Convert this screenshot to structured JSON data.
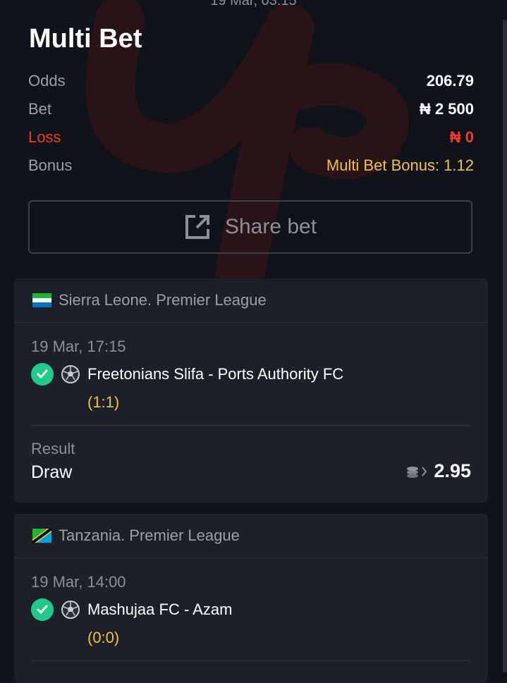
{
  "header": {
    "top_date": "19 Mar, 03:15",
    "title": "Multi Bet"
  },
  "summary": {
    "odds_label": "Odds",
    "odds_value": "206.79",
    "bet_label": "Bet",
    "bet_value": "₦ 2 500",
    "loss_label": "Loss",
    "loss_value": "₦ 0",
    "bonus_label": "Bonus",
    "bonus_value": "Multi Bet Bonus: 1.12"
  },
  "share": {
    "label": "Share bet"
  },
  "cards": [
    {
      "league": "Sierra Leone. Premier League",
      "flag_colors": [
        "#1eb53a",
        "#ffffff",
        "#0072c6"
      ],
      "date": "19 Mar, 17:15",
      "match": "Freetonians Slifa - Ports Authority FC",
      "score": "(1:1)",
      "result_label": "Result",
      "result_value": "Draw",
      "odds": "2.95"
    },
    {
      "league": "Tanzania. Premier League",
      "date": "19 Mar, 14:00",
      "match": "Mashujaa FC - Azam",
      "score": "(0:0)"
    }
  ],
  "colors": {
    "background": "#101319",
    "card": "#1d2028",
    "loss": "#f03a2a",
    "bonus": "#f2c43a",
    "check": "#21c98a"
  }
}
